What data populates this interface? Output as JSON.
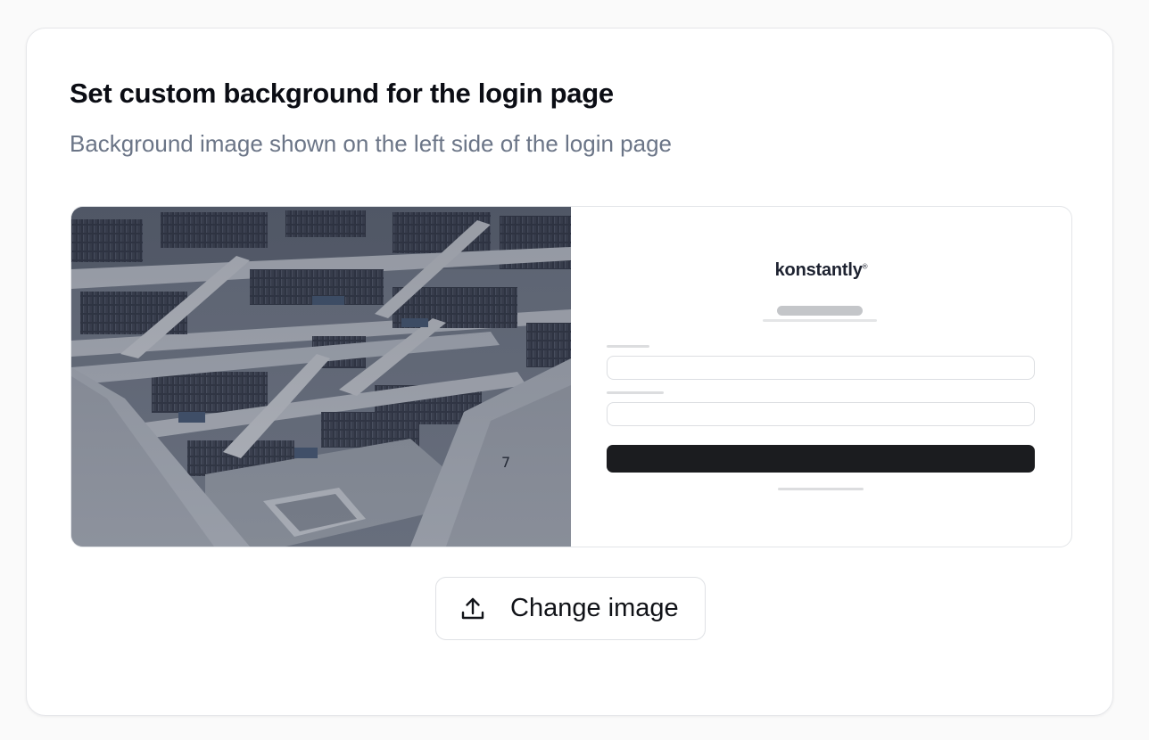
{
  "section": {
    "title": "Set custom background for the login page",
    "subtitle": "Background image shown on the left side of the login page"
  },
  "preview": {
    "background_image": "library-interior-photo",
    "brand_name": "konstantly",
    "brand_mark": "®"
  },
  "actions": {
    "change_image_label": "Change image",
    "change_image_icon": "upload-icon"
  },
  "colors": {
    "title": "#0b0d14",
    "subtitle": "#6b7587",
    "mock_button": "#1b1c1f"
  }
}
